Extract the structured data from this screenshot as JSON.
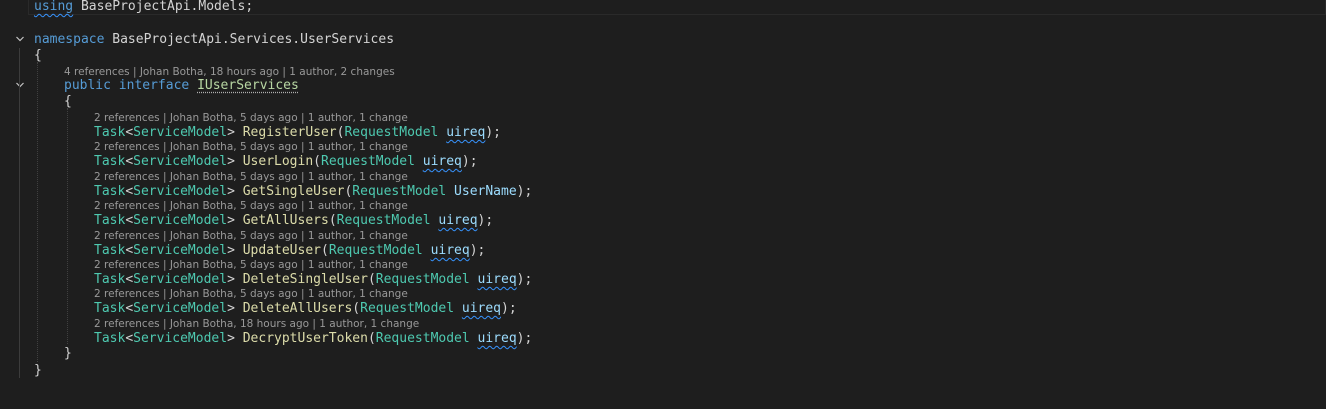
{
  "colors": {
    "background": "#1e1e1e",
    "keyword": "#569cd6",
    "type": "#4ec9b0",
    "method": "#dcdcaa",
    "parameter": "#9cdcfe",
    "codelens": "#999999"
  },
  "code": {
    "using_keyword": "using",
    "using_namespace": "BaseProjectApi.Models",
    "using_semicolon": ";",
    "namespace_keyword": "namespace",
    "namespace_name": "BaseProjectApi.Services.UserServices",
    "ns_open_brace": "{",
    "ns_close_brace": "}",
    "interface_lens": "4 references | Johan Botha, 18 hours ago | 1 author, 2 changes",
    "public_keyword": "public",
    "interface_keyword": "interface",
    "interface_name": "IUserServices",
    "iface_open_brace": "{",
    "iface_close_brace": "}",
    "methods": [
      {
        "lens": "2 references | Johan Botha, 5 days ago | 1 author, 1 change",
        "return_type": "Task",
        "generic_arg": "ServiceModel",
        "name": "RegisterUser",
        "param_type": "RequestModel",
        "param_name": "uireq"
      },
      {
        "lens": "2 references | Johan Botha, 5 days ago | 1 author, 1 change",
        "return_type": "Task",
        "generic_arg": "ServiceModel",
        "name": "UserLogin",
        "param_type": "RequestModel",
        "param_name": "uireq"
      },
      {
        "lens": "2 references | Johan Botha, 5 days ago | 1 author, 1 change",
        "return_type": "Task",
        "generic_arg": "ServiceModel",
        "name": "GetSingleUser",
        "param_type": "RequestModel",
        "param_name": "UserName"
      },
      {
        "lens": "2 references | Johan Botha, 5 days ago | 1 author, 1 change",
        "return_type": "Task",
        "generic_arg": "ServiceModel",
        "name": "GetAllUsers",
        "param_type": "RequestModel",
        "param_name": "uireq"
      },
      {
        "lens": "2 references | Johan Botha, 5 days ago | 1 author, 1 change",
        "return_type": "Task",
        "generic_arg": "ServiceModel",
        "name": "UpdateUser",
        "param_type": "RequestModel",
        "param_name": "uireq"
      },
      {
        "lens": "2 references | Johan Botha, 5 days ago | 1 author, 1 change",
        "return_type": "Task",
        "generic_arg": "ServiceModel",
        "name": "DeleteSingleUser",
        "param_type": "RequestModel",
        "param_name": "uireq"
      },
      {
        "lens": "2 references | Johan Botha, 5 days ago | 1 author, 1 change",
        "return_type": "Task",
        "generic_arg": "ServiceModel",
        "name": "DeleteAllUsers",
        "param_type": "RequestModel",
        "param_name": "uireq"
      },
      {
        "lens": "2 references | Johan Botha, 18 hours ago | 1 author, 1 change",
        "return_type": "Task",
        "generic_arg": "ServiceModel",
        "name": "DecryptUserToken",
        "param_type": "RequestModel",
        "param_name": "uireq"
      }
    ]
  },
  "icons": {
    "fold_namespace": "chevron-down-icon",
    "fold_interface": "chevron-down-icon"
  }
}
